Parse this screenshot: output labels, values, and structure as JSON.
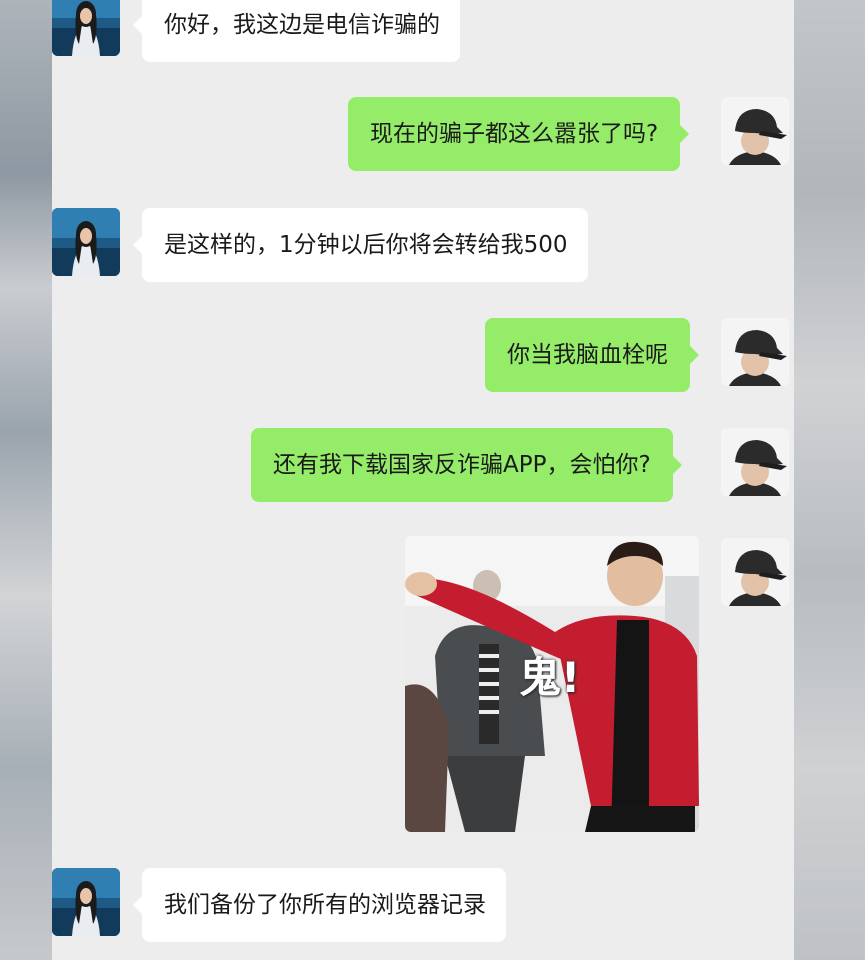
{
  "conversation": {
    "messages": [
      {
        "side": "in",
        "type": "text",
        "text": "你好，我这边是电信诈骗的"
      },
      {
        "side": "out",
        "type": "text",
        "text": "现在的骗子都这么嚣张了吗?"
      },
      {
        "side": "in",
        "type": "text",
        "text": "是这样的，1分钟以后你将会转给我500"
      },
      {
        "side": "out",
        "type": "text",
        "text": "你当我脑血栓呢"
      },
      {
        "side": "out",
        "type": "text",
        "text": "还有我下载国家反诈骗APP，会怕你?"
      },
      {
        "side": "out",
        "type": "sticker",
        "caption": "鬼!"
      },
      {
        "side": "in",
        "type": "text",
        "text": "我们备份了你所有的浏览器记录"
      }
    ]
  },
  "colors": {
    "chat_background": "#ededed",
    "incoming_bubble": "#ffffff",
    "outgoing_bubble": "#95ec69"
  },
  "icons": {
    "contact_avatar": "woman-portrait-avatar",
    "self_avatar": "man-in-cap-avatar"
  }
}
